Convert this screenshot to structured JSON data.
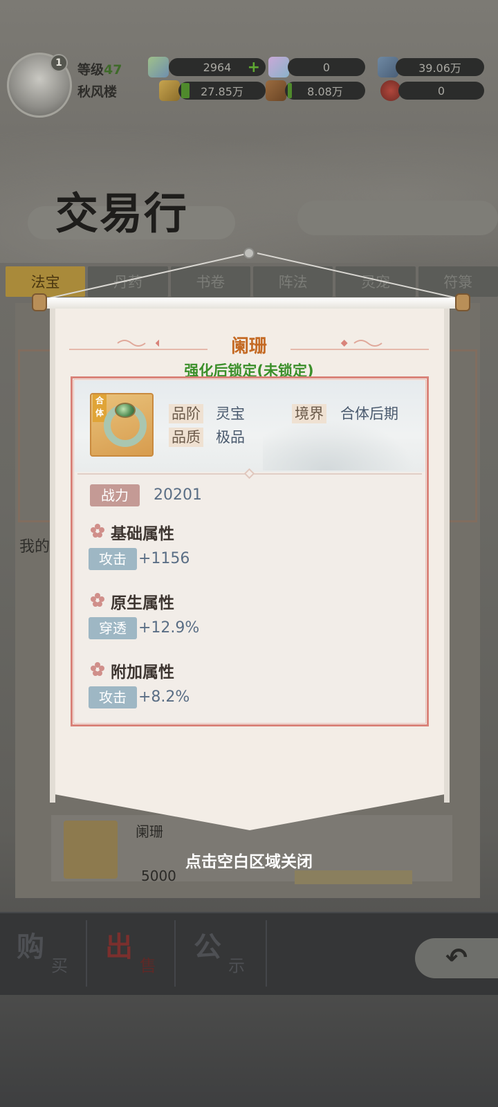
{
  "player": {
    "level_label": "等级",
    "level_value": "47",
    "name": "秋风楼",
    "badge": "1"
  },
  "resources": [
    {
      "icon": "spirit-stone-icon",
      "value": "2964",
      "has_plus": true
    },
    {
      "icon": "crystal-icon",
      "value": "0",
      "has_plus": false
    },
    {
      "icon": "gem-icon",
      "value": "39.06万",
      "has_plus": false
    },
    {
      "icon": "gold-ingot-icon",
      "value": "27.85万",
      "has_plus": false
    },
    {
      "icon": "ore-icon",
      "value": "8.08万",
      "has_plus": false
    },
    {
      "icon": "seal-icon",
      "value": "0",
      "has_plus": false
    }
  ],
  "page_title": "交易行",
  "tabs": [
    "法宝",
    "丹药",
    "书卷",
    "阵法",
    "灵宠",
    "符箓"
  ],
  "active_tab": 0,
  "background": {
    "my_label": "我的",
    "item_name": "阑珊",
    "item_price": "5000"
  },
  "bottom_nav": {
    "buy": {
      "big": "购",
      "small": "买"
    },
    "sell": {
      "big": "出",
      "small": "售"
    },
    "notice": {
      "big": "公",
      "small": "示"
    }
  },
  "popup": {
    "item_name": "阑珊",
    "lock_status": "强化后锁定(未锁定)",
    "icon_tag": "合体",
    "grade_label": "品阶",
    "grade_value": "灵宝",
    "realm_label": "境界",
    "realm_value": "合体后期",
    "quality_label": "品质",
    "quality_value": "极品",
    "power_label": "战力",
    "power_value": "20201",
    "sections": [
      {
        "title": "基础属性",
        "attr_label": "攻击",
        "attr_value": "+1156"
      },
      {
        "title": "原生属性",
        "attr_label": "穿透",
        "attr_value": "+12.9%"
      },
      {
        "title": "附加属性",
        "attr_label": "攻击",
        "attr_value": "+8.2%"
      }
    ],
    "close_hint": "点击空白区域关闭"
  },
  "colors": {
    "title_orange": "#c46a24",
    "lock_green": "#3b8f2a",
    "frame_red": "#d9837a",
    "attr_blue": "#9eb7c4",
    "power_rose": "#c49a95"
  }
}
